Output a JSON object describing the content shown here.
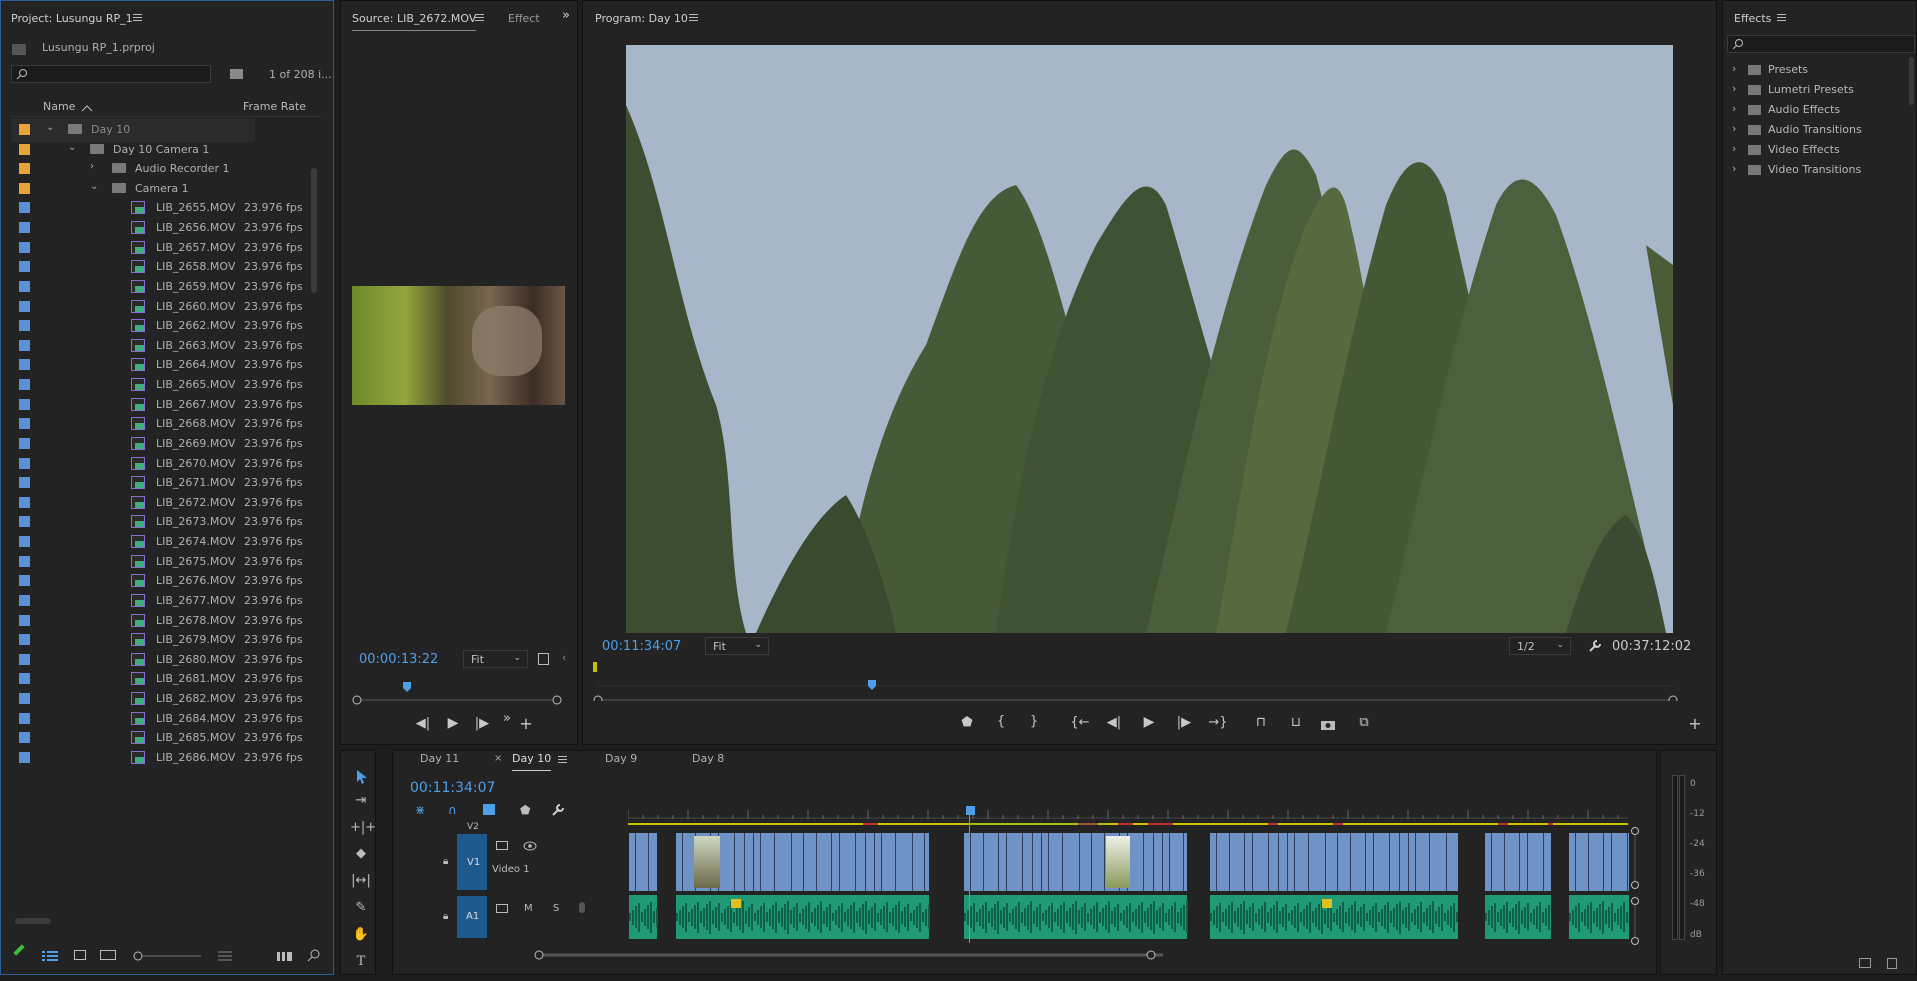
{
  "colors": {
    "accent": "#4d9fe8",
    "audio_clip": "#1f9a74",
    "video_clip": "#6e93c4",
    "folder_label": "#e8a33a",
    "clip_label": "#5b8fd6"
  },
  "project": {
    "title": "Project: Lusungu RP_1",
    "file": "Lusungu RP_1.prproj",
    "count": "1 of 208 i...",
    "col_name": "Name",
    "col_framerate": "Frame Rate",
    "folders": [
      {
        "name": "Day 10"
      },
      {
        "name": "Day 10 Camera 1"
      },
      {
        "name": "Audio Recorder 1"
      },
      {
        "name": "Camera 1"
      }
    ],
    "fps": "23.976 fps",
    "clips": [
      "LIB_2655.MOV",
      "LIB_2656.MOV",
      "LIB_2657.MOV",
      "LIB_2658.MOV",
      "LIB_2659.MOV",
      "LIB_2660.MOV",
      "LIB_2662.MOV",
      "LIB_2663.MOV",
      "LIB_2664.MOV",
      "LIB_2665.MOV",
      "LIB_2667.MOV",
      "LIB_2668.MOV",
      "LIB_2669.MOV",
      "LIB_2670.MOV",
      "LIB_2671.MOV",
      "LIB_2672.MOV",
      "LIB_2673.MOV",
      "LIB_2674.MOV",
      "LIB_2675.MOV",
      "LIB_2676.MOV",
      "LIB_2677.MOV",
      "LIB_2678.MOV",
      "LIB_2679.MOV",
      "LIB_2680.MOV",
      "LIB_2681.MOV",
      "LIB_2682.MOV",
      "LIB_2684.MOV",
      "LIB_2685.MOV",
      "LIB_2686.MOV"
    ]
  },
  "source": {
    "title": "Source: LIB_2672.MOV",
    "tab2": "Effect",
    "timecode": "00:00:13:22",
    "zoom": "Fit"
  },
  "program": {
    "title": "Program: Day 10",
    "timecode": "00:11:34:07",
    "zoom": "Fit",
    "resolution": "1/2",
    "duration": "00:37:12:02"
  },
  "effects": {
    "title": "Effects",
    "items": [
      "Presets",
      "Lumetri Presets",
      "Audio Effects",
      "Audio Transitions",
      "Video Effects",
      "Video Transitions"
    ]
  },
  "timeline": {
    "tabs": [
      "Day 11",
      "Day 10",
      "Day 9",
      "Day 8"
    ],
    "active_tab": "Day 10",
    "timecode": "00:11:34:07",
    "tracks": {
      "v2": "V2",
      "v1": "V1",
      "video1_name": "Video 1",
      "a1": "A1",
      "mute": "M",
      "solo": "S"
    }
  },
  "meter": {
    "labels": [
      "0",
      "-12",
      "-24",
      "-36",
      "-48",
      "dB"
    ]
  }
}
